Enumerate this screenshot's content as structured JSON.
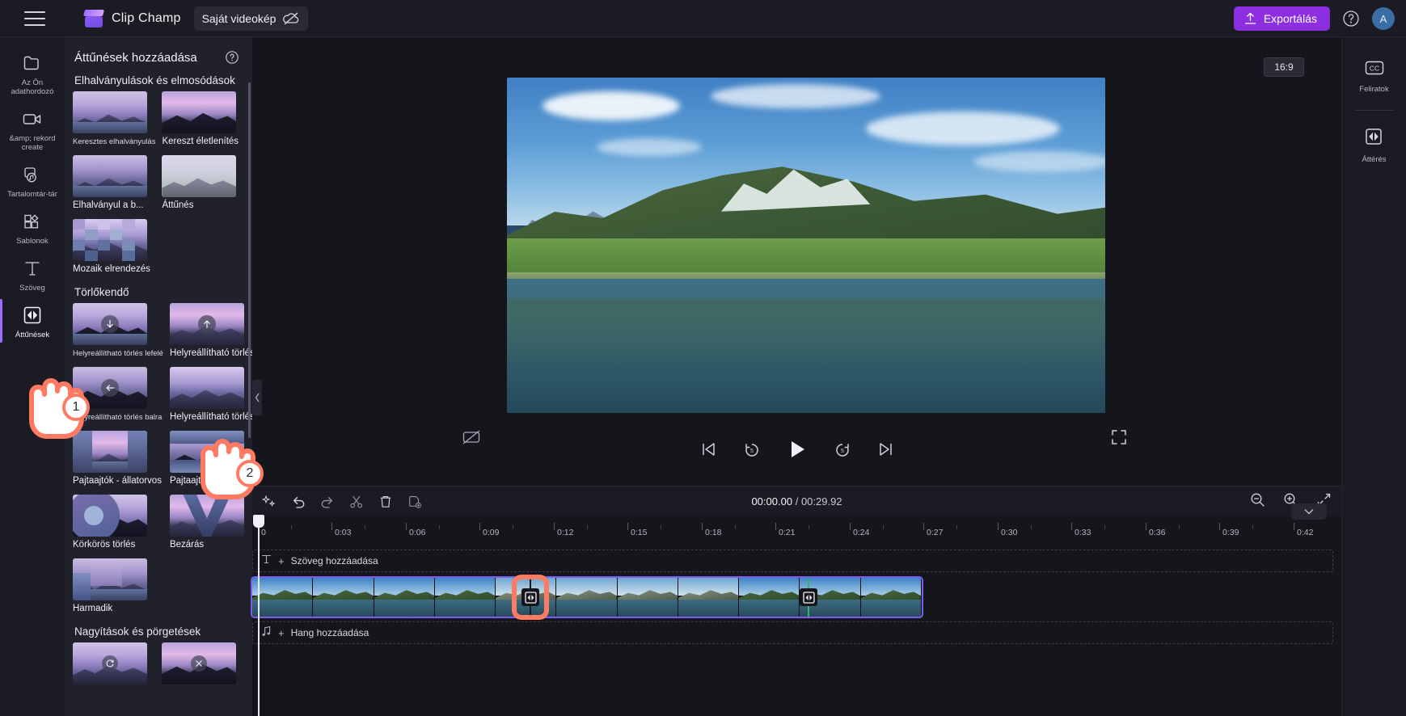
{
  "app": {
    "brand": "Clip Champ",
    "project_name": "Saját videokép",
    "export_label": "Exportálás",
    "avatar_initial": "A"
  },
  "left_rail": {
    "items": [
      {
        "label": "Az Ön adathordozó",
        "icon": "folder-icon",
        "active": false
      },
      {
        "label": "&amp; rekord create",
        "icon": "video-camera-icon",
        "active": false
      },
      {
        "label": "Tartalomtár-tár",
        "icon": "content-library-icon",
        "active": false
      },
      {
        "label": "Sablonok",
        "icon": "templates-icon",
        "active": false
      },
      {
        "label": "Szöveg",
        "icon": "text-icon",
        "active": false
      },
      {
        "label": "Áttűnések",
        "icon": "transitions-icon",
        "active": true
      }
    ]
  },
  "panel": {
    "title": "Áttűnések hozzáadása",
    "help_icon": "question-mark-icon",
    "sections": [
      {
        "title": "Elhalványulások és elmosódások",
        "items": [
          {
            "label": "Keresztes elhalványulás",
            "thumb": "fade-cross",
            "size": "small"
          },
          {
            "label": "Kereszt életlenítés",
            "thumb": "cross-blur",
            "size": "big"
          },
          {
            "label": "Elhalványul a b...",
            "thumb": "fade-to",
            "size": "big"
          },
          {
            "label": "Áttűnés",
            "thumb": "dissolve",
            "size": "big",
            "overflow": "..."
          },
          {
            "label": "Mozaik elrendezés",
            "thumb": "mosaic",
            "size": "big"
          }
        ]
      },
      {
        "title": "Törlőkendő",
        "items": [
          {
            "label": "Helyreállítható törlés lefelé",
            "thumb": "wipe-down",
            "size": "small"
          },
          {
            "label": "Helyreállítható törlés felfelé",
            "thumb": "wipe-up",
            "size": "big"
          },
          {
            "label": "Helyreállítható törlés balra",
            "thumb": "wipe-left",
            "size": "small"
          },
          {
            "label": "Helyreállítható törlés jobbra",
            "thumb": "wipe-right",
            "size": "big"
          },
          {
            "label": "Pajtaajtók - állatorvos",
            "thumb": "barn-vertical",
            "size": "big"
          },
          {
            "label": "Pajtaajtók - h.",
            "thumb": "barn-horizontal",
            "size": "big",
            "overflow": "..."
          },
          {
            "label": "Körkörös törlés",
            "thumb": "circle-wipe",
            "size": "big"
          },
          {
            "label": "Bezárás",
            "thumb": "close-wipe",
            "size": "big"
          },
          {
            "label": "Harmadik",
            "thumb": "third",
            "size": "big"
          }
        ]
      },
      {
        "title": "Nagyítások és pörgetések",
        "items": [
          {
            "label": "",
            "thumb": "zoom-spin-1",
            "size": "big"
          },
          {
            "label": "",
            "thumb": "zoom-spin-2",
            "size": "big"
          }
        ]
      }
    ]
  },
  "preview": {
    "aspect_ratio": "16:9",
    "transport": {
      "captions_toggle": "captions-off-icon",
      "skip_back": "skip-to-start-icon",
      "back_5": "rewind-5-icon",
      "play": "play-icon",
      "forward_5": "forward-5-icon",
      "skip_forward": "skip-to-end-icon",
      "fullscreen": "fullscreen-icon"
    }
  },
  "right_rail": {
    "items": [
      {
        "label": "Feliratok",
        "icon": "closed-captions-icon"
      },
      {
        "label": "Áttérés",
        "icon": "transition-icon"
      }
    ]
  },
  "timeline": {
    "toolbar": {
      "magic": "magic-wand-icon",
      "undo": "undo-icon",
      "redo": "redo-icon",
      "split": "scissors-icon",
      "delete": "trash-icon",
      "duplicate": "duplicate-icon",
      "zoom_out": "zoom-out-icon",
      "zoom_in": "zoom-in-icon",
      "fit": "fit-to-screen-icon"
    },
    "current_time": "00:00.00",
    "separator": "/",
    "total_time": "00:29.92",
    "ruler_labels": [
      "0",
      "0:03",
      "0:06",
      "0:09",
      "0:12",
      "0:15",
      "0:18",
      "0:21",
      "0:24",
      "0:27",
      "0:30",
      "0:33",
      "0:36",
      "0:39",
      "0:42"
    ],
    "tracks": {
      "text_label": "Szöveg hozzáadása",
      "text_icon": "text-track-icon",
      "audio_label": "Hang hozzáadása",
      "audio_icon": "music-note-icon",
      "plus": "+"
    },
    "markers": [
      {
        "type": "transition-marker",
        "highlighted": true
      },
      {
        "type": "transition-marker",
        "highlighted": false
      }
    ]
  },
  "callouts": [
    {
      "number": "1",
      "target": "sidebar-transitions"
    },
    {
      "number": "2",
      "target": "transition-wipe-right"
    }
  ],
  "colors": {
    "accent": "#8b2fe0",
    "highlight": "#ff7a63",
    "clip_outline": "#7c5cf0",
    "marker_green": "#2fb46a",
    "panel_bg": "#21212b",
    "rail_bg": "#1b1b24",
    "stage_bg": "#15151c"
  }
}
